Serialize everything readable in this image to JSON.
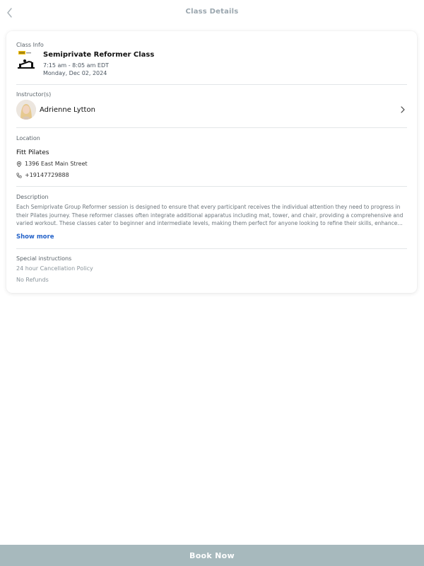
{
  "header": {
    "title": "Class Details"
  },
  "class_info": {
    "section_label": "Class Info",
    "name": "Semiprivate Reformer Class",
    "time": "7:15 am - 8:05 am EDT",
    "date": "Monday, Dec 02, 2024",
    "logo_icon": "fitt-reformer-logo"
  },
  "instructor": {
    "section_label": "Instructor(s)",
    "name": "Adrienne Lytton",
    "avatar_icon": "instructor-avatar"
  },
  "location": {
    "section_label": "Location",
    "name": "Fitt Pilates",
    "address": "1396 East Main Street",
    "phone": "+19147729888"
  },
  "description": {
    "section_label": "Description",
    "text": "Each Semiprivate Group Reformer session is designed to ensure that every participant receives the individual attention they need to progress in their Pilates journey. These reformer classes often integrate additional apparatus including mat, tower, and chair, providing a comprehensive and varied workout. These classes cater to beginner and intermediate levels, making them perfect for anyone looking to refine their skills, enhance their core...",
    "show_more_label": "Show more"
  },
  "special_instructions": {
    "section_label": "Special instructions",
    "lines": [
      "24 hour Cancellation Policy",
      "No Refunds"
    ]
  },
  "footer": {
    "book_label": "Book Now"
  },
  "colors": {
    "accent": "#2563c9",
    "book_button": "#a7b9bd"
  }
}
